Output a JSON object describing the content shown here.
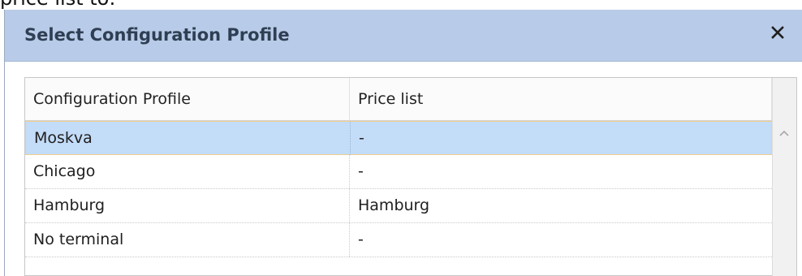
{
  "background_text": "price list to:",
  "dialog": {
    "title": "Select Configuration Profile",
    "close_icon": "close-icon",
    "grid": {
      "columns": [
        "Configuration Profile",
        "Price list"
      ],
      "rows": [
        {
          "profile": "Moskva",
          "price_list": "-",
          "selected": true
        },
        {
          "profile": "Chicago",
          "price_list": "-",
          "selected": false
        },
        {
          "profile": "Hamburg",
          "price_list": "Hamburg",
          "selected": false
        },
        {
          "profile": "No terminal",
          "price_list": "-",
          "selected": false
        }
      ]
    }
  },
  "colors": {
    "titlebar": "#b8cbe8",
    "selected_row": "#c3dcf8",
    "selected_border": "#f2cf8c",
    "title_text": "#2f3f53"
  }
}
